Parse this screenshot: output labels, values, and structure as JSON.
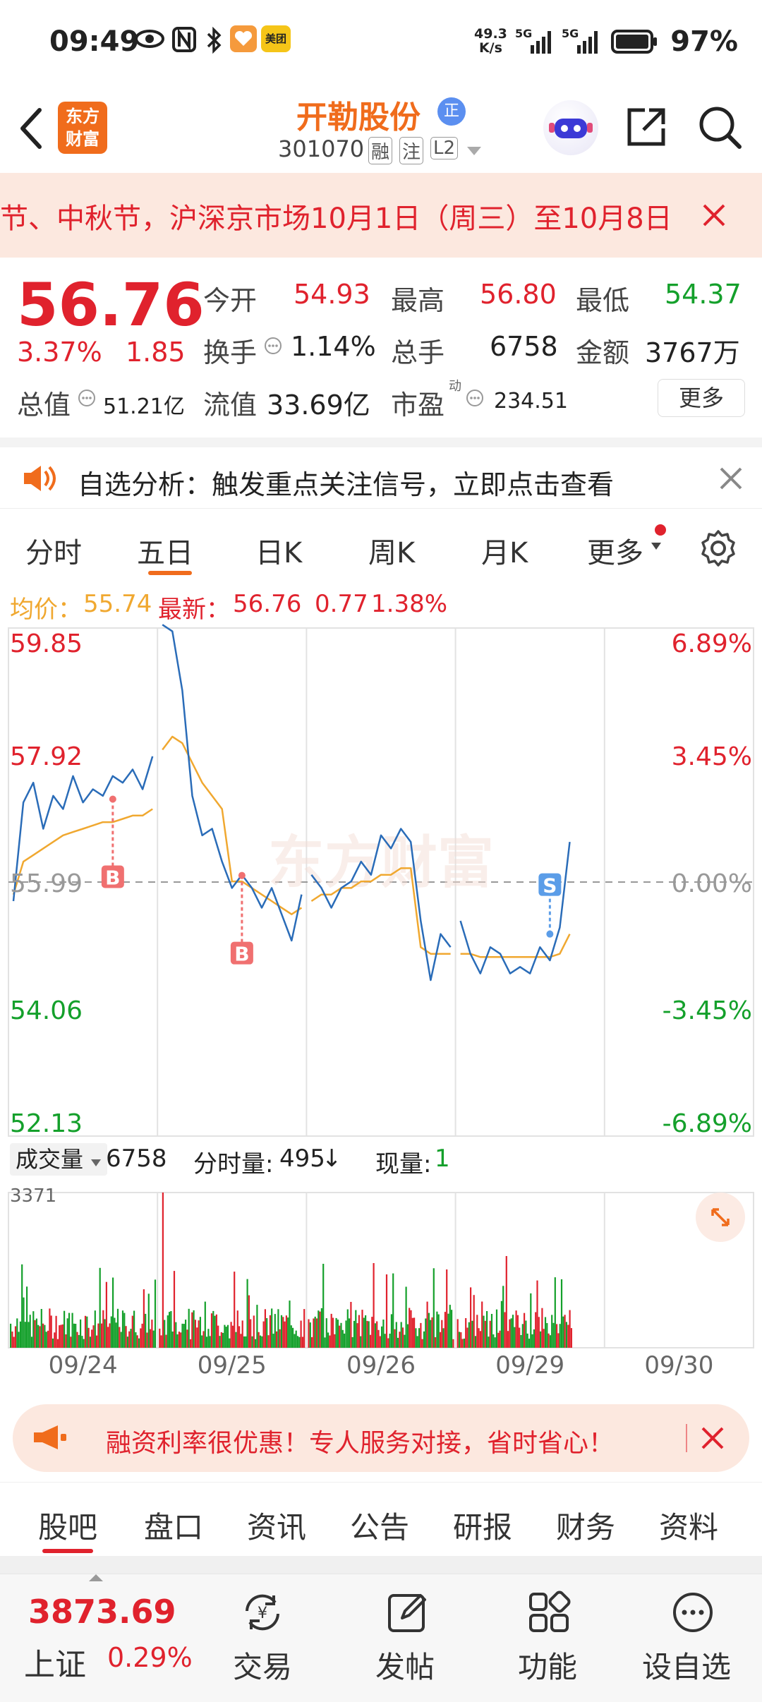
{
  "status_bar": {
    "time": "09:49",
    "network_speed_value": "49.3",
    "network_speed_unit": "K/s",
    "signal1": "5G",
    "signal2": "5G",
    "battery": "97%",
    "app_badge": "美团"
  },
  "header": {
    "logo_line1": "东方",
    "logo_line2": "财富",
    "stock_name": "开勒股份",
    "stock_badge": "正",
    "stock_code": "301070",
    "tag_rong": "融",
    "tag_zhu": "注",
    "tag_l2": "L2"
  },
  "banner": {
    "text": "节、中秋节，沪深京市场10月1日（周三）至10月8日"
  },
  "quote": {
    "price": "56.76",
    "change_pct": "3.37%",
    "change_amt": "1.85",
    "open_label": "今开",
    "open": "54.93",
    "high_label": "最高",
    "high": "56.80",
    "low_label": "最低",
    "low": "54.37",
    "turnover_label": "换手",
    "turnover": "1.14%",
    "volume_label": "总手",
    "volume": "6758",
    "amount_label": "金额",
    "amount": "3767万",
    "mktcap_label": "总值",
    "mktcap": "51.21亿",
    "float_label": "流值",
    "float": "33.69亿",
    "pe_label": "市盈",
    "pe_sup": "动",
    "pe": "234.51",
    "more": "更多"
  },
  "notice": {
    "text": "自选分析：触发重点关注信号，立即点击查看"
  },
  "tabs": {
    "items": [
      "分时",
      "五日",
      "日K",
      "周K",
      "月K",
      "更多"
    ],
    "active": 1
  },
  "avg_line": {
    "avg_label": "均价：",
    "avg": "55.74",
    "latest_label": "最新：",
    "latest": "56.76",
    "chg": "0.77",
    "chg_pct": "1.38%"
  },
  "chart_data": {
    "type": "line",
    "title": "",
    "price_axis": [
      "59.85",
      "57.92",
      "55.99",
      "54.06",
      "52.13"
    ],
    "pct_axis": [
      "6.89%",
      "3.45%",
      "0.00%",
      "-3.45%",
      "-6.89%"
    ],
    "ylim": [
      52.13,
      59.85
    ],
    "reference_price": 55.99,
    "dates": [
      "09/24",
      "09/25",
      "09/26",
      "09/29",
      "09/30"
    ],
    "series": [
      {
        "name": "",
        "color": "#2a6cb8",
        "values": [
          55.7,
          57.2,
          57.5,
          56.8,
          57.3,
          57.1,
          57.6,
          57.2,
          57.4,
          57.3,
          57.6,
          57.5,
          57.7,
          57.4,
          57.9,
          59.9,
          59.8,
          58.9,
          57.3,
          56.7,
          56.8,
          56.3,
          55.9,
          56.1,
          55.9,
          55.6,
          55.9,
          55.5,
          55.1,
          55.8,
          56.1,
          55.9,
          55.6,
          55.9,
          56.0,
          56.3,
          56.1,
          56.7,
          56.5,
          56.8,
          56.6,
          55.4,
          54.5,
          55.2,
          55.0,
          55.4,
          54.9,
          54.6,
          55.0,
          54.9,
          54.6,
          54.7,
          54.6,
          55.0,
          54.8,
          55.3,
          56.6
        ]
      },
      {
        "name": "",
        "color": "#f0a830",
        "values": [
          55.8,
          56.3,
          56.4,
          56.5,
          56.6,
          56.7,
          56.75,
          56.8,
          56.85,
          56.9,
          56.9,
          56.95,
          57.0,
          57.0,
          57.1,
          58.0,
          58.2,
          58.1,
          57.8,
          57.5,
          57.3,
          57.1,
          56.0,
          56.0,
          55.9,
          55.8,
          55.7,
          55.6,
          55.5,
          55.6,
          55.7,
          55.8,
          55.8,
          55.9,
          55.9,
          56.0,
          56.0,
          56.1,
          56.1,
          56.2,
          56.2,
          55.0,
          54.9,
          54.9,
          54.9,
          54.9,
          54.9,
          54.85,
          54.85,
          54.85,
          54.85,
          54.85,
          54.85,
          54.85,
          54.85,
          54.9,
          55.2
        ]
      }
    ],
    "markers": [
      {
        "label": "B",
        "type": "buy",
        "x_index": 10,
        "price": 57.25
      },
      {
        "label": "B",
        "type": "buy",
        "x_index": 23,
        "price": 56.09
      },
      {
        "label": "S",
        "type": "sell",
        "x_index": 54,
        "price": 55.2
      }
    ],
    "volume": {
      "label": "成交量",
      "total": "6758",
      "minute_label": "分时量:",
      "minute": "495",
      "minute_arrow": "↓",
      "now_label": "现量:",
      "now": "1",
      "max": "3371"
    }
  },
  "ad": {
    "text": "融资利率很优惠！专人服务对接，省时省心！"
  },
  "bottom_tabs": [
    "股吧",
    "盘口",
    "资讯",
    "公告",
    "研报",
    "财务",
    "资料"
  ],
  "bottom_bar": {
    "index_value": "3873.69",
    "index_name": "上证",
    "index_pct": "0.29%",
    "trade": "交易",
    "post": "发帖",
    "function": "功能",
    "watch": "设自选"
  },
  "colors": {
    "up": "#e0222d",
    "down": "#14a02b",
    "accent": "#f06c1c",
    "price_line": "#2a6cb8",
    "avg_line": "#f0a830"
  }
}
